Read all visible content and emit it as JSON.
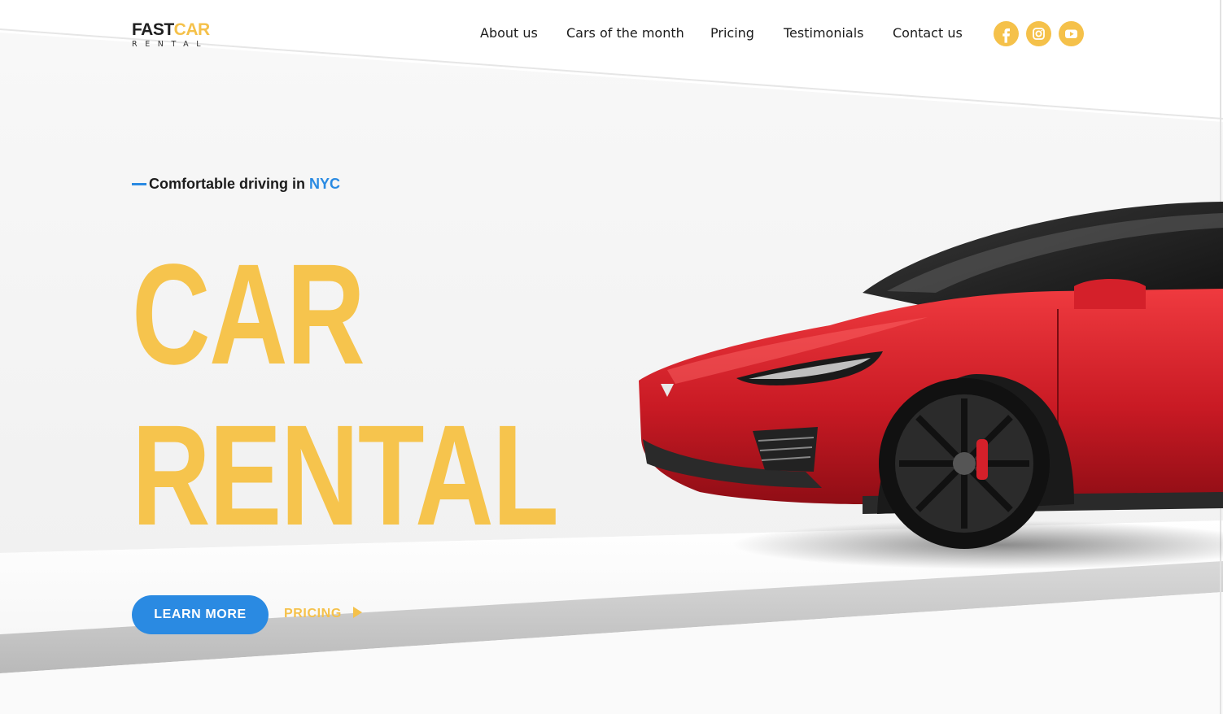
{
  "colors": {
    "accent_yellow": "#f5c14a",
    "accent_blue": "#2a8ae2",
    "text_dark": "#1c1c1c",
    "car_red": "#d4202a"
  },
  "logo": {
    "main_dark": "FAST",
    "main_accent": "CAR",
    "sub": "RENTAL"
  },
  "nav": {
    "items": [
      {
        "label": "About us"
      },
      {
        "label": "Cars of the month"
      },
      {
        "label": "Pricing"
      },
      {
        "label": "Testimonials"
      },
      {
        "label": "Contact us"
      }
    ]
  },
  "social": {
    "icons": [
      "facebook-icon",
      "instagram-icon",
      "youtube-icon"
    ]
  },
  "hero": {
    "tagline_prefix": "Comfortable driving in ",
    "tagline_city": "NYC",
    "title_line1": "CAR",
    "title_line2": "RENTAL",
    "learn_more": "LEARN MORE",
    "pricing": "PRICING"
  }
}
